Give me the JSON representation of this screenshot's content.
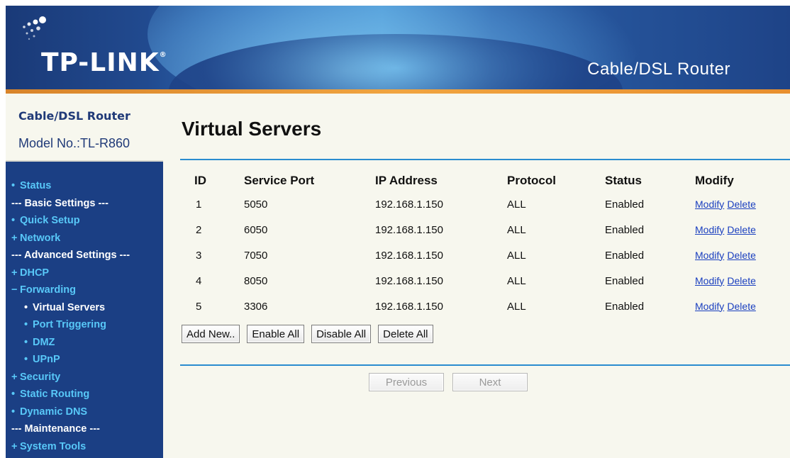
{
  "header": {
    "logo_text": "TP-LINK",
    "logo_mark": "®",
    "title": "Cable/DSL Router"
  },
  "sidebar": {
    "product": "Cable/DSL Router",
    "model": "Model No.:TL-R860",
    "items": [
      {
        "label": "Status",
        "mark": "•",
        "type": "item"
      },
      {
        "label": "--- Basic Settings ---",
        "mark": "",
        "type": "section"
      },
      {
        "label": "Quick Setup",
        "mark": "•",
        "type": "item"
      },
      {
        "label": "Network",
        "mark": "+",
        "type": "item"
      },
      {
        "label": "--- Advanced Settings ---",
        "mark": "",
        "type": "section"
      },
      {
        "label": "DHCP",
        "mark": "+",
        "type": "item"
      },
      {
        "label": "Forwarding",
        "mark": "−",
        "type": "item"
      },
      {
        "label": "Virtual Servers",
        "mark": "•",
        "type": "sub-active"
      },
      {
        "label": "Port Triggering",
        "mark": "•",
        "type": "sub"
      },
      {
        "label": "DMZ",
        "mark": "•",
        "type": "sub"
      },
      {
        "label": "UPnP",
        "mark": "•",
        "type": "sub"
      },
      {
        "label": "Security",
        "mark": "+",
        "type": "item"
      },
      {
        "label": "Static Routing",
        "mark": "•",
        "type": "item"
      },
      {
        "label": "Dynamic DNS",
        "mark": "•",
        "type": "item"
      },
      {
        "label": "--- Maintenance ---",
        "mark": "",
        "type": "section"
      },
      {
        "label": "System Tools",
        "mark": "+",
        "type": "item"
      }
    ]
  },
  "main": {
    "title": "Virtual Servers",
    "columns": [
      "ID",
      "Service Port",
      "IP Address",
      "Protocol",
      "Status",
      "Modify"
    ],
    "rows": [
      {
        "id": "1",
        "port": "5050",
        "ip": "192.168.1.150",
        "protocol": "ALL",
        "status": "Enabled"
      },
      {
        "id": "2",
        "port": "6050",
        "ip": "192.168.1.150",
        "protocol": "ALL",
        "status": "Enabled"
      },
      {
        "id": "3",
        "port": "7050",
        "ip": "192.168.1.150",
        "protocol": "ALL",
        "status": "Enabled"
      },
      {
        "id": "4",
        "port": "8050",
        "ip": "192.168.1.150",
        "protocol": "ALL",
        "status": "Enabled"
      },
      {
        "id": "5",
        "port": "3306",
        "ip": "192.168.1.150",
        "protocol": "ALL",
        "status": "Enabled"
      }
    ],
    "modify_label": "Modify",
    "delete_label": "Delete",
    "buttons": {
      "add_new": "Add New..",
      "enable_all": "Enable All",
      "disable_all": "Disable All",
      "delete_all": "Delete All"
    },
    "pager": {
      "previous": "Previous",
      "next": "Next"
    }
  },
  "colors": {
    "header_blue": "#1a3a78",
    "accent_orange": "#e88f2e",
    "sidebar_bg": "#1b3f84",
    "menu_link": "#58c8f8",
    "rule_blue": "#2a8ccf",
    "panel_bg": "#f7f7ee",
    "link_blue": "#1a3fbf"
  }
}
